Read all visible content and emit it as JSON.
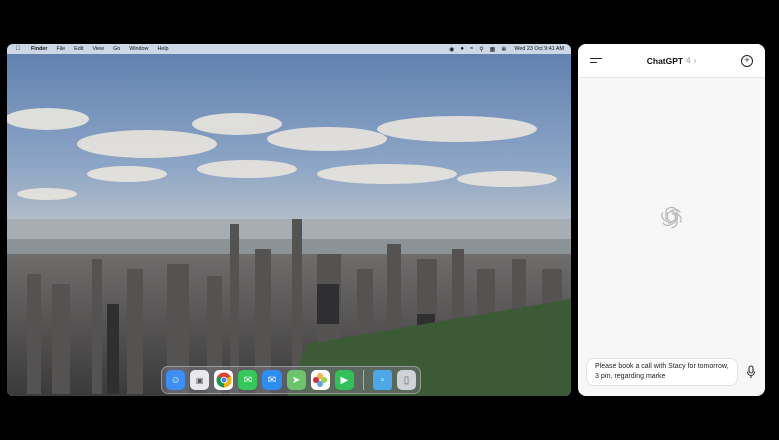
{
  "menubar": {
    "apple_icon": "apple-icon",
    "app_name": "Finder",
    "menus": [
      "File",
      "Edit",
      "View",
      "Go",
      "Window",
      "Help"
    ],
    "status_icons": [
      "screen-mirror-icon",
      "siri-icon",
      "wifi-icon",
      "search-icon",
      "control-center-icon",
      "settings-icon"
    ],
    "clock": "Wed 23 Oct  9:41 AM"
  },
  "dock": {
    "apps": [
      {
        "name": "finder-icon",
        "color": "#3b8ff6"
      },
      {
        "name": "launchpad-icon",
        "color": "#e8e8ee"
      },
      {
        "name": "chrome-icon",
        "color": "#ffffff"
      },
      {
        "name": "messages-icon",
        "color": "#34c759"
      },
      {
        "name": "mail-icon",
        "color": "#2d8cf0"
      },
      {
        "name": "maps-icon",
        "color": "#6cc56d"
      },
      {
        "name": "photos-icon",
        "color": "#ffffff"
      },
      {
        "name": "facetime-icon",
        "color": "#30c15a"
      },
      {
        "name": "folder-icon",
        "color": "#4ba7e8"
      },
      {
        "name": "trash-icon",
        "color": "#cfd3d8"
      }
    ]
  },
  "chat": {
    "title": "ChatGPT",
    "version": "4",
    "input_value": "Please book a call with Stacy for tomorrow, 3 pm, regarding marke",
    "accent": "#111111"
  }
}
